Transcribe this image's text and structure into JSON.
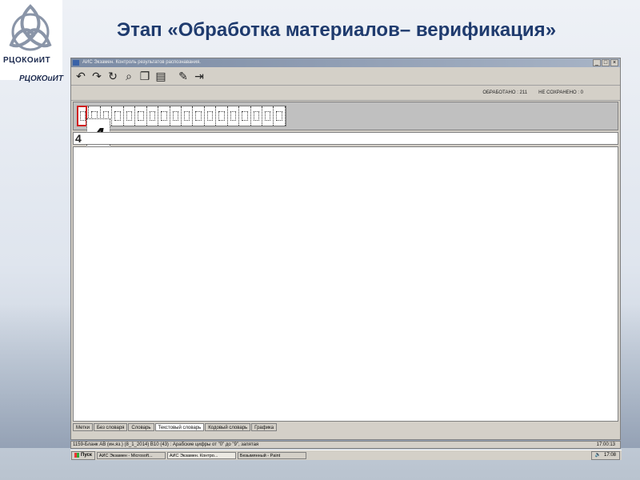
{
  "slide": {
    "title": "Этап «Обработка материалов– верификация»",
    "logo_text": "РЦОКОиИТ",
    "logo_text_repeat": "РЦОКОиИТ"
  },
  "app": {
    "window_title": "АИС Экзамен. Контроль результатов распознавания.",
    "processed_label": "ОБРАБОТАНО :",
    "processed_value": "211",
    "unsaved_label": "НЕ СОХРАНЕНО :",
    "unsaved_value": "0",
    "zoomed_glyph": "4",
    "input_value": "4",
    "tabs": [
      "Метки",
      "Без словаря",
      "Словарь",
      "Текстовый словарь",
      "Кодовый словарь",
      "Графика"
    ],
    "active_tab": "Текстовый словарь",
    "info_text": "1159-Бланк АВ (ин.яз.) (8_1_2014)  В10 (43) : Арабские цифры от \"0\" до \"9\", запятая",
    "info_time": "17:00:13"
  },
  "taskbar": {
    "start_label": "Пуск",
    "items": [
      "АИС Экзамен - Microsoft...",
      "АИС Экзамен. Контро...",
      "Безымянный - Paint"
    ],
    "clock": "17:08"
  }
}
